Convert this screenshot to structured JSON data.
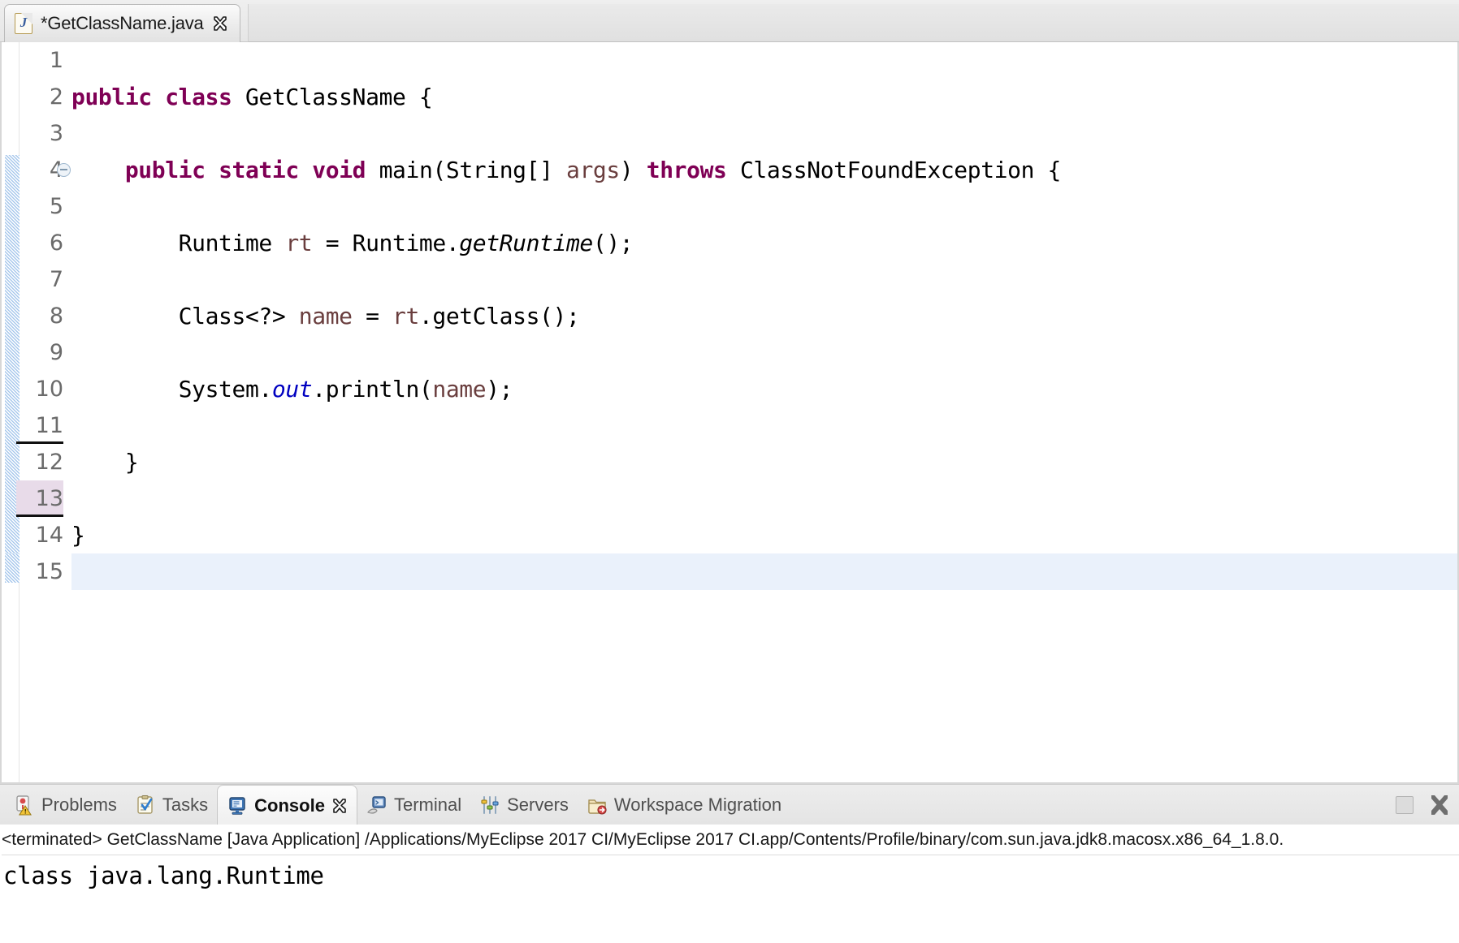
{
  "editor": {
    "tab": {
      "label": "*GetClassName.java",
      "icon": "java-file-icon",
      "close_icon": "close-icon",
      "dirty": true
    },
    "gutter": {
      "line_numbers": [
        "1",
        "2",
        "3",
        "4",
        "5",
        "6",
        "7",
        "8",
        "9",
        "10",
        "11",
        "12",
        "13",
        "14",
        "15"
      ],
      "highlighted_line": "13",
      "fold_marker_line": "4",
      "separator_after_lines": [
        "11",
        "13"
      ]
    },
    "caret_line": "15",
    "code_lines": [
      {
        "n": "1",
        "tokens": []
      },
      {
        "n": "2",
        "tokens": [
          {
            "t": "public",
            "c": "kw"
          },
          {
            "t": " ",
            "c": ""
          },
          {
            "t": "class",
            "c": "kw"
          },
          {
            "t": " GetClassName {",
            "c": ""
          }
        ]
      },
      {
        "n": "3",
        "tokens": []
      },
      {
        "n": "4",
        "tokens": [
          {
            "t": "    ",
            "c": ""
          },
          {
            "t": "public",
            "c": "kw"
          },
          {
            "t": " ",
            "c": ""
          },
          {
            "t": "static",
            "c": "kw"
          },
          {
            "t": " ",
            "c": ""
          },
          {
            "t": "void",
            "c": "kw"
          },
          {
            "t": " main(String[] ",
            "c": ""
          },
          {
            "t": "args",
            "c": "var"
          },
          {
            "t": ") ",
            "c": ""
          },
          {
            "t": "throws",
            "c": "kw"
          },
          {
            "t": " ClassNotFoundException {",
            "c": ""
          }
        ]
      },
      {
        "n": "5",
        "tokens": []
      },
      {
        "n": "6",
        "tokens": [
          {
            "t": "        Runtime ",
            "c": ""
          },
          {
            "t": "rt",
            "c": "var"
          },
          {
            "t": " = Runtime.",
            "c": ""
          },
          {
            "t": "getRuntime",
            "c": "smth"
          },
          {
            "t": "();",
            "c": ""
          }
        ]
      },
      {
        "n": "7",
        "tokens": []
      },
      {
        "n": "8",
        "tokens": [
          {
            "t": "        Class<?> ",
            "c": ""
          },
          {
            "t": "name",
            "c": "var"
          },
          {
            "t": " = ",
            "c": ""
          },
          {
            "t": "rt",
            "c": "var"
          },
          {
            "t": ".getClass();",
            "c": ""
          }
        ]
      },
      {
        "n": "9",
        "tokens": []
      },
      {
        "n": "10",
        "tokens": [
          {
            "t": "        System.",
            "c": ""
          },
          {
            "t": "out",
            "c": "sfld"
          },
          {
            "t": ".println(",
            "c": ""
          },
          {
            "t": "name",
            "c": "var"
          },
          {
            "t": ");",
            "c": ""
          }
        ]
      },
      {
        "n": "11",
        "tokens": []
      },
      {
        "n": "12",
        "tokens": [
          {
            "t": "    }",
            "c": ""
          }
        ]
      },
      {
        "n": "13",
        "tokens": []
      },
      {
        "n": "14",
        "tokens": [
          {
            "t": "}",
            "c": ""
          }
        ]
      },
      {
        "n": "15",
        "tokens": []
      }
    ],
    "colors": {
      "keyword": "#7F0055",
      "variable": "#6A3E3E",
      "static_field": "#0000C0",
      "plain": "#000000",
      "gutter_number": "#6B6B6B",
      "current_line_highlight": "#EAF1FB",
      "gutter_highlight": "#E8DBE9",
      "change_ribbon": "#A8C8EC"
    }
  },
  "bottom_view": {
    "tabs": [
      {
        "label": "Problems",
        "icon": "problems-icon",
        "active": false,
        "closable": false
      },
      {
        "label": "Tasks",
        "icon": "tasks-icon",
        "active": false,
        "closable": false
      },
      {
        "label": "Console",
        "icon": "console-icon",
        "active": true,
        "closable": true
      },
      {
        "label": "Terminal",
        "icon": "terminal-icon",
        "active": false,
        "closable": false
      },
      {
        "label": "Servers",
        "icon": "servers-icon",
        "active": false,
        "closable": false
      },
      {
        "label": "Workspace Migration",
        "icon": "workspace-migration-icon",
        "active": false,
        "closable": false
      }
    ],
    "actions": {
      "minimize_icon": "minimize-icon",
      "close_icon": "close-icon"
    },
    "console": {
      "header": "<terminated> GetClassName [Java Application] /Applications/MyEclipse 2017 CI/MyEclipse 2017 CI.app/Contents/Profile/binary/com.sun.java.jdk8.macosx.x86_64_1.8.0.",
      "output": "class java.lang.Runtime"
    }
  }
}
